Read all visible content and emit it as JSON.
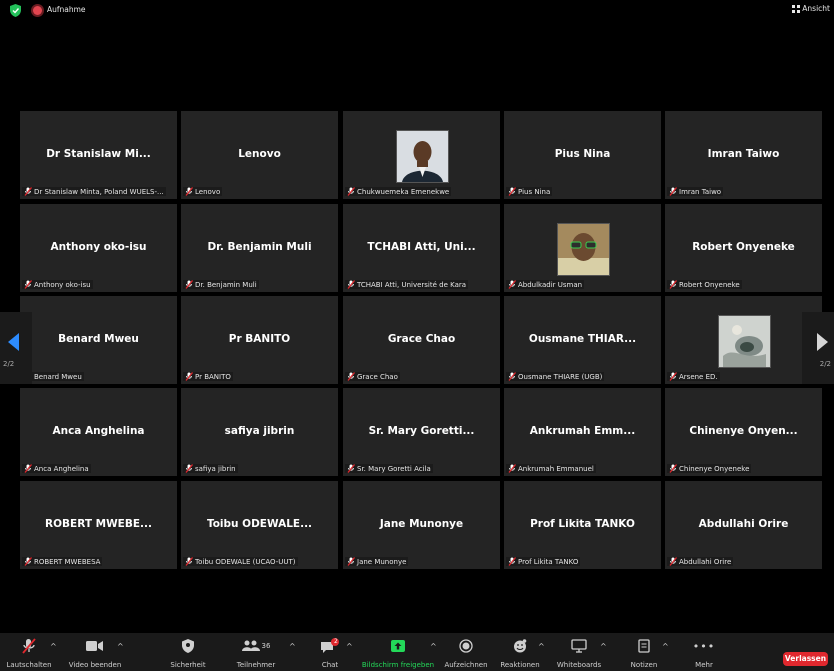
{
  "topbar": {
    "recording_label": "Aufnahme",
    "view_label": "Ansicht"
  },
  "participants": [
    {
      "display": "Dr Stanislaw Mi...",
      "label": "Dr Stanislaw Minta, Poland WUELS-..."
    },
    {
      "display": "Lenovo",
      "label": "Lenovo"
    },
    {
      "display": "",
      "label": "Chukwuemeka Emenekwe",
      "avatar": "man-suit-photo"
    },
    {
      "display": "Pius Nina",
      "label": "Pius Nina"
    },
    {
      "display": "Imran Taiwo",
      "label": "Imran Taiwo"
    },
    {
      "display": "Anthony oko-isu",
      "label": "Anthony oko-isu"
    },
    {
      "display": "Dr. Benjamin Muli",
      "label": "Dr. Benjamin Muli"
    },
    {
      "display": "TCHABI Atti, Uni...",
      "label": "TCHABI Atti, Université de Kara"
    },
    {
      "display": "",
      "label": "Abdulkadir Usman",
      "avatar": "man-glasses-photo"
    },
    {
      "display": "Robert Onyeneke",
      "label": "Robert Onyeneke"
    },
    {
      "display": "Benard Mweu",
      "label": "Benard Mweu"
    },
    {
      "display": "Pr BANITO",
      "label": "Pr BANITO"
    },
    {
      "display": "Grace Chao",
      "label": "Grace Chao"
    },
    {
      "display": "Ousmane THIAR...",
      "label": "Ousmane THIARE (UGB)"
    },
    {
      "display": "",
      "label": "Arsene ED.",
      "avatar": "abstract-photo"
    },
    {
      "display": "Anca Anghelina",
      "label": "Anca Anghelina"
    },
    {
      "display": "safiya jibrin",
      "label": "safiya jibrin"
    },
    {
      "display": "Sr. Mary Goretti...",
      "label": "Sr. Mary Goretti Acila"
    },
    {
      "display": "Ankrumah Emm...",
      "label": "Ankrumah Emmanuel"
    },
    {
      "display": "Chinenye Onyen...",
      "label": "Chinenye Onyeneke"
    },
    {
      "display": "ROBERT MWEBE...",
      "label": "ROBERT MWEBESA"
    },
    {
      "display": "Toibu ODEWALE...",
      "label": "Toibu ODEWALE (UCAO-UUT)"
    },
    {
      "display": "Jane Munonye",
      "label": "Jane Munonye"
    },
    {
      "display": "Prof Likita TANKO",
      "label": "Prof Likita TANKO"
    },
    {
      "display": "Abdullahi Orire",
      "label": "Abdullahi Orire"
    }
  ],
  "pager": {
    "left": "2/2",
    "right": "2/2"
  },
  "toolbar": {
    "mute": "Lautschalten",
    "video": "Video beenden",
    "security": "Sicherheit",
    "participants": "Teilnehmer",
    "participants_count": "36",
    "chat": "Chat",
    "chat_badge": "2",
    "share": "Bildschirm freigeben",
    "record": "Aufzeichnen",
    "reactions": "Reaktionen",
    "whiteboards": "Whiteboards",
    "notes": "Notizen",
    "more": "Mehr",
    "leave": "Verlassen"
  },
  "colors": {
    "accent": "#2d8cff",
    "share_green": "#23d959",
    "leave_red": "#e0282e",
    "tile_bg": "#242424"
  }
}
